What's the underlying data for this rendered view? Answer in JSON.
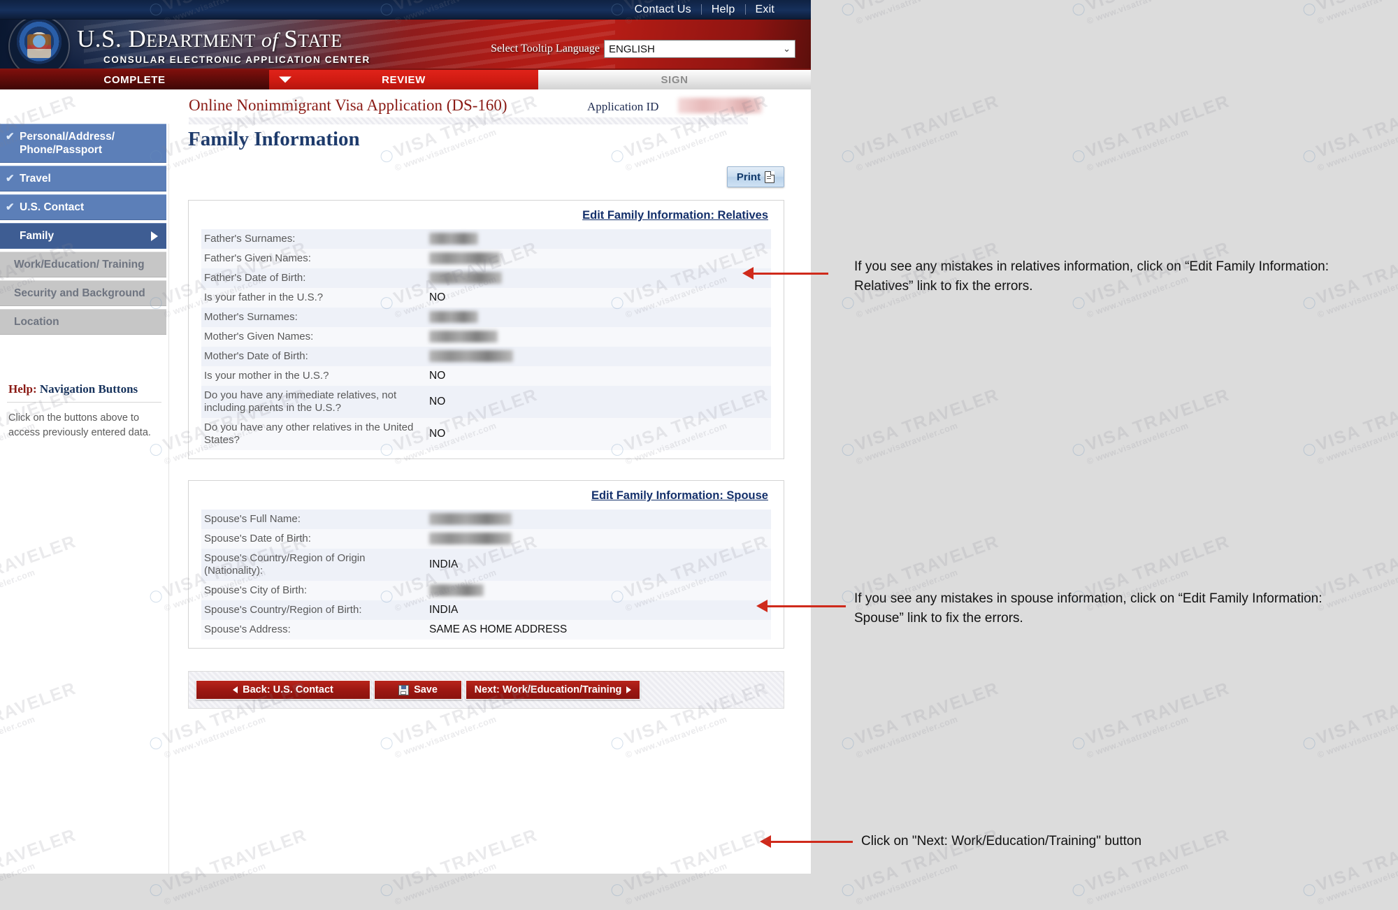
{
  "utility_bar": {
    "links": [
      "Contact Us",
      "Help",
      "Exit"
    ]
  },
  "banner": {
    "title_prefix": "U.S. ",
    "title_department": "D",
    "title_epartment": "EPARTMENT",
    "title_of": " of ",
    "title_s": "S",
    "title_tate": "TATE",
    "subtitle": "CONSULAR ELECTRONIC APPLICATION CENTER",
    "tooltip_label": "Select Tooltip Language",
    "tooltip_value": "ENGLISH",
    "tooltip_options": [
      "ENGLISH"
    ],
    "chevron": "⌄"
  },
  "steps": [
    {
      "label": "COMPLETE",
      "state": "done"
    },
    {
      "label": "REVIEW",
      "state": "current"
    },
    {
      "label": "SIGN",
      "state": "upcoming"
    }
  ],
  "app_header": {
    "form_title": "Online Nonimmigrant Visa Application (DS-160)",
    "application_id_label": "Application ID",
    "application_id_value": ""
  },
  "sidebar": {
    "items": [
      {
        "label": "Personal/Address/ Phone/Passport",
        "state": "completed",
        "check": "✔"
      },
      {
        "label": "Travel",
        "state": "completed",
        "check": "✔"
      },
      {
        "label": "U.S. Contact",
        "state": "completed",
        "check": "✔"
      },
      {
        "label": "Family",
        "state": "active",
        "check": ""
      },
      {
        "label": "Work/Education/ Training",
        "state": "disabled",
        "check": ""
      },
      {
        "label": "Security and Background",
        "state": "disabled",
        "check": ""
      },
      {
        "label": "Location",
        "state": "disabled",
        "check": ""
      }
    ],
    "help": {
      "title_prefix": "Help:",
      "title_rest": " Navigation Buttons",
      "body": "Click on the buttons above to access previously entered data."
    }
  },
  "main": {
    "page_title": "Family Information",
    "print_label": "Print",
    "relatives": {
      "edit_link": "Edit Family Information: Relatives",
      "rows": [
        {
          "label": "Father's Surnames:",
          "value": "",
          "redacted": true,
          "redact_width": 70
        },
        {
          "label": "Father's Given Names:",
          "value": "",
          "redacted": true,
          "redact_width": 102
        },
        {
          "label": "Father's Date of Birth:",
          "value": "",
          "redacted": true,
          "redact_width": 104
        },
        {
          "label": "Is your father in the U.S.?",
          "value": "NO",
          "redacted": false
        },
        {
          "label": "Mother's Surnames:",
          "value": "",
          "redacted": true,
          "redact_width": 70
        },
        {
          "label": "Mother's Given Names:",
          "value": "",
          "redacted": true,
          "redact_width": 98
        },
        {
          "label": "Mother's Date of Birth:",
          "value": "",
          "redacted": true,
          "redact_width": 120
        },
        {
          "label": "Is your mother in the U.S.?",
          "value": "NO",
          "redacted": false
        },
        {
          "label": "Do you have any immediate relatives, not including parents in the U.S.?",
          "value": "NO",
          "redacted": false
        },
        {
          "label": "Do you have any other relatives in the United States?",
          "value": "NO",
          "redacted": false
        }
      ]
    },
    "spouse": {
      "edit_link": "Edit Family Information: Spouse",
      "rows": [
        {
          "label": "Spouse's Full Name:",
          "value": "",
          "redacted": true,
          "redact_width": 118
        },
        {
          "label": "Spouse's Date of Birth:",
          "value": "",
          "redacted": true,
          "redact_width": 118
        },
        {
          "label": "Spouse's Country/Region of Origin (Nationality):",
          "value": "INDIA",
          "redacted": false
        },
        {
          "label": "Spouse's City of Birth:",
          "value": "",
          "redacted": true,
          "redact_width": 78
        },
        {
          "label": "Spouse's Country/Region of Birth:",
          "value": "INDIA",
          "redacted": false
        },
        {
          "label": "Spouse's Address:",
          "value": "SAME AS HOME ADDRESS",
          "redacted": false
        }
      ]
    },
    "nav": {
      "back_label": "Back: U.S. Contact",
      "save_label": "Save",
      "next_label": "Next: Work/Education/Training"
    }
  },
  "annotations": [
    {
      "text": "If you see any mistakes in relatives information, click on “Edit Family Information: Relatives” link to fix the errors."
    },
    {
      "text": "If you see any mistakes in spouse information, click on “Edit Family Information: Spouse” link to fix the errors."
    },
    {
      "text": "Click on \"Next: Work/Education/Training\" button"
    }
  ],
  "watermark": {
    "big": "VISA TRAVELER",
    "small": "© www.visatraveler.com"
  }
}
